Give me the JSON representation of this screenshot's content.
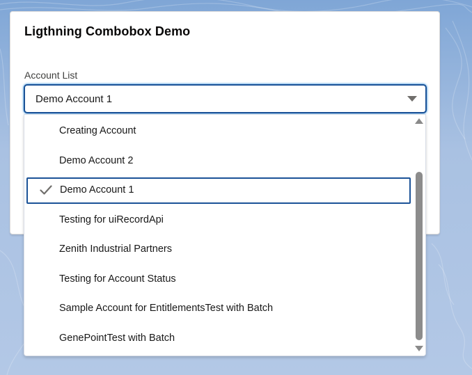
{
  "card": {
    "title": "Ligthning Combobox Demo"
  },
  "combobox": {
    "label": "Account List",
    "value": "Demo Account 1",
    "options": [
      {
        "label": "Creating Account",
        "selected": false
      },
      {
        "label": "Demo Account 2",
        "selected": false
      },
      {
        "label": "Demo Account 1",
        "selected": true
      },
      {
        "label": "Testing for uiRecordApi",
        "selected": false
      },
      {
        "label": "Zenith Industrial Partners",
        "selected": false
      },
      {
        "label": "Testing for Account Status",
        "selected": false
      },
      {
        "label": "Sample Account for EntitlementsTest with Batch",
        "selected": false
      },
      {
        "label": "GenePointTest with Batch",
        "selected": false
      }
    ]
  },
  "icons": {
    "check": "check-icon",
    "caret": "chevron-down-icon",
    "scroll_up": "scroll-up-arrow-icon",
    "scroll_down": "scroll-down-arrow-icon"
  },
  "colors": {
    "focus_border": "#1b5297",
    "background": "#b3c8e6"
  }
}
